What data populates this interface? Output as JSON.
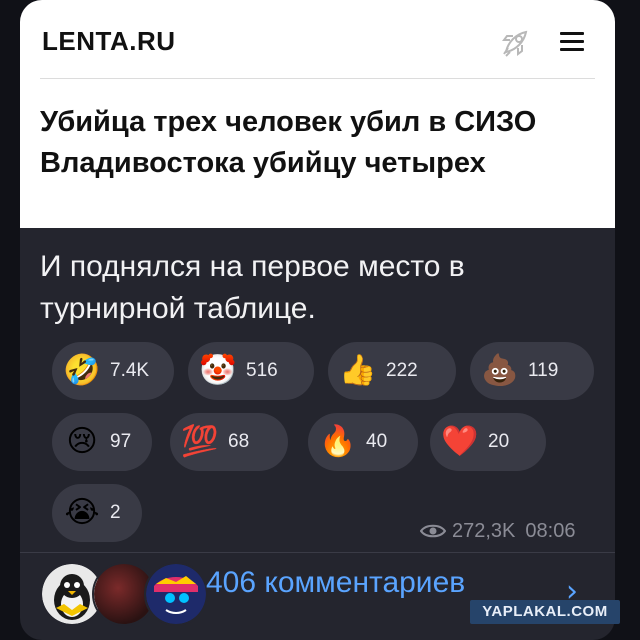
{
  "preview": {
    "logo": "LENTA.RU",
    "headline": "Убийца трех человек убил в СИЗО Владивостока убийцу четырех"
  },
  "message": {
    "text": "И поднялся на первое место в турнирной таблице."
  },
  "reactions": [
    {
      "emoji": "🤣",
      "count": "7.4K"
    },
    {
      "emoji": "🤡",
      "count": "516"
    },
    {
      "emoji": "👍",
      "count": "222"
    },
    {
      "emoji": "💩",
      "count": "119"
    },
    {
      "emoji": "😢",
      "count": "97"
    },
    {
      "emoji": "💯",
      "count": "68"
    },
    {
      "emoji": "🔥",
      "count": "40"
    },
    {
      "emoji": "❤️",
      "count": "20"
    },
    {
      "emoji": "😭",
      "count": "2"
    }
  ],
  "meta": {
    "views": "272,3K",
    "time": "08:06"
  },
  "footer": {
    "comments_label": "406 комментариев",
    "watermark": "YAPLAKAL.COM"
  },
  "colors": {
    "card_bg": "#24252e",
    "reaction_bg": "#393a45",
    "link": "#5aa4ff"
  }
}
